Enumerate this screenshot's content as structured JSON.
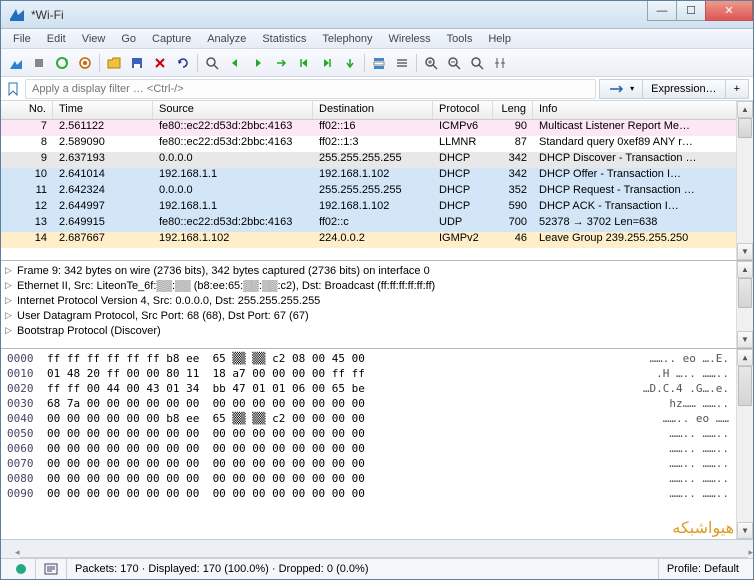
{
  "window": {
    "title": "*Wi-Fi"
  },
  "menu": [
    "File",
    "Edit",
    "View",
    "Go",
    "Capture",
    "Analyze",
    "Statistics",
    "Telephony",
    "Wireless",
    "Tools",
    "Help"
  ],
  "filter": {
    "placeholder": "Apply a display filter … <Ctrl-/>",
    "expression_btn": "Expression…",
    "plus_btn": "+"
  },
  "columns": {
    "no": "No.",
    "time": "Time",
    "source": "Source",
    "destination": "Destination",
    "protocol": "Protocol",
    "length": "Leng",
    "info": "Info"
  },
  "packets": [
    {
      "no": "7",
      "time": "2.561122",
      "src": "fe80::ec22:d53d:2bbc:4163",
      "dst": "ff02::16",
      "proto": "ICMPv6",
      "len": "90",
      "info": "Multicast Listener Report Me…",
      "bg": "#fde6f5"
    },
    {
      "no": "8",
      "time": "2.589090",
      "src": "fe80::ec22:d53d:2bbc:4163",
      "dst": "ff02::1:3",
      "proto": "LLMNR",
      "len": "87",
      "info": "Standard query 0xef89 ANY r…",
      "bg": "#ffffff"
    },
    {
      "no": "9",
      "time": "2.637193",
      "src": "0.0.0.0",
      "dst": "255.255.255.255",
      "proto": "DHCP",
      "len": "342",
      "info": "DHCP Discover - Transaction …",
      "bg": "#e8e8e8"
    },
    {
      "no": "10",
      "time": "2.641014",
      "src": "192.168.1.1",
      "dst": "192.168.1.102",
      "proto": "DHCP",
      "len": "342",
      "info": "DHCP Offer     - Transaction I…",
      "bg": "#d2e6f8"
    },
    {
      "no": "11",
      "time": "2.642324",
      "src": "0.0.0.0",
      "dst": "255.255.255.255",
      "proto": "DHCP",
      "len": "352",
      "info": "DHCP Request - Transaction …",
      "bg": "#d2e6f8"
    },
    {
      "no": "12",
      "time": "2.644997",
      "src": "192.168.1.1",
      "dst": "192.168.1.102",
      "proto": "DHCP",
      "len": "590",
      "info": "DHCP ACK      - Transaction I…",
      "bg": "#d2e6f8"
    },
    {
      "no": "13",
      "time": "2.649915",
      "src": "fe80::ec22:d53d:2bbc:4163",
      "dst": "ff02::c",
      "proto": "UDP",
      "len": "700",
      "info": "52378 → 3702  Len=638",
      "bg": "#d2e6f8"
    },
    {
      "no": "14",
      "time": "2.687667",
      "src": "192.168.1.102",
      "dst": "224.0.0.2",
      "proto": "IGMPv2",
      "len": "46",
      "info": "Leave Group 239.255.255.250",
      "bg": "#ffeeca"
    }
  ],
  "details": [
    "Frame 9: 342 bytes on wire (2736 bits), 342 bytes captured (2736 bits) on interface 0",
    "Ethernet II, Src: LiteonTe_6f:▒▒:▒▒ (b8:ee:65:▒▒:▒▒:c2), Dst: Broadcast (ff:ff:ff:ff:ff:ff)",
    "Internet Protocol Version 4, Src: 0.0.0.0, Dst: 255.255.255.255",
    "User Datagram Protocol, Src Port: 68 (68), Dst Port: 67 (67)",
    "Bootstrap Protocol (Discover)"
  ],
  "hex": [
    {
      "off": "0000",
      "bytes": "ff ff ff ff ff ff b8 ee  65 ▒▒ ▒▒ c2 08 00 45 00",
      "ascii": "…….. eo ….E."
    },
    {
      "off": "0010",
      "bytes": "01 48 20 ff 00 00 80 11  18 a7 00 00 00 00 ff ff",
      "ascii": ".H ….. …….."
    },
    {
      "off": "0020",
      "bytes": "ff ff 00 44 00 43 01 34  bb 47 01 01 06 00 65 be",
      "ascii": "…D.C.4 .G….e."
    },
    {
      "off": "0030",
      "bytes": "68 7a 00 00 00 00 00 00  00 00 00 00 00 00 00 00",
      "ascii": "hz…… …….."
    },
    {
      "off": "0040",
      "bytes": "00 00 00 00 00 00 b8 ee  65 ▒▒ ▒▒ c2 00 00 00 00",
      "ascii": "…….. eo ……"
    },
    {
      "off": "0050",
      "bytes": "00 00 00 00 00 00 00 00  00 00 00 00 00 00 00 00",
      "ascii": "…….. …….."
    },
    {
      "off": "0060",
      "bytes": "00 00 00 00 00 00 00 00  00 00 00 00 00 00 00 00",
      "ascii": "…….. …….."
    },
    {
      "off": "0070",
      "bytes": "00 00 00 00 00 00 00 00  00 00 00 00 00 00 00 00",
      "ascii": "…….. …….."
    },
    {
      "off": "0080",
      "bytes": "00 00 00 00 00 00 00 00  00 00 00 00 00 00 00 00",
      "ascii": "…….. …….."
    },
    {
      "off": "0090",
      "bytes": "00 00 00 00 00 00 00 00  00 00 00 00 00 00 00 00",
      "ascii": "…….. …….."
    }
  ],
  "status": {
    "packets": "Packets: 170 · Displayed: 170 (100.0%) · Dropped: 0 (0.0%)",
    "profile": "Profile: Default"
  },
  "watermark": "هیواشبکه"
}
